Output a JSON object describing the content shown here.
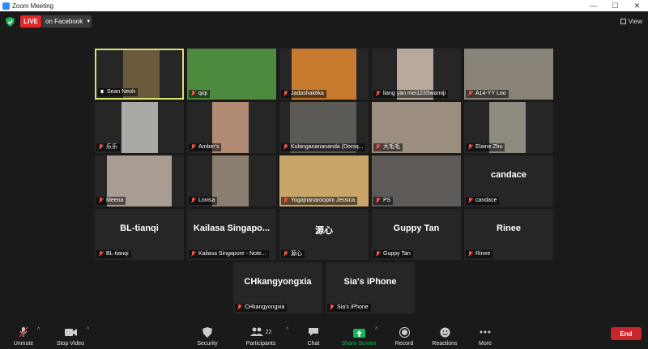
{
  "window": {
    "title": "Zoom Meeting",
    "controls": [
      "—",
      "☐",
      "✕"
    ]
  },
  "topbar": {
    "live_label": "LIVE",
    "live_destination": "on Facebook",
    "view_label": "View"
  },
  "participants": [
    {
      "name": "Sean Neoh",
      "muted": false,
      "pinned": true,
      "video": true,
      "active_speaker": true,
      "photo_color": "#6b5a3c"
    },
    {
      "name": "qiqi",
      "muted": true,
      "video": true,
      "photo_color": "#4e8a3e"
    },
    {
      "name": "Jadashaktika",
      "muted": true,
      "video": true,
      "photo_color": "#c77a2e"
    },
    {
      "name": "liang yan mei123Swamiji",
      "muted": true,
      "video": true,
      "photo_color": "#b9a99a"
    },
    {
      "name": "A14-YY Loo",
      "muted": true,
      "video": true,
      "photo_color": "#8a8378"
    },
    {
      "name": "乐乐",
      "muted": true,
      "video": true,
      "photo_color": "#a8a8a4"
    },
    {
      "name": "Amber's",
      "muted": true,
      "video": true,
      "photo_color": "#b28b74"
    },
    {
      "name": "Kulangananananda (Dorsq...",
      "muted": true,
      "video": true,
      "photo_color": "#5b5a55"
    },
    {
      "name": "大毛毛",
      "muted": true,
      "video": true,
      "photo_color": "#9b8e7e"
    },
    {
      "name": "Elaine Zhu",
      "muted": true,
      "video": true,
      "photo_color": "#8f8a80"
    },
    {
      "name": "Meena",
      "muted": true,
      "video": true,
      "photo_color": "#a99c93"
    },
    {
      "name": "Lovisa",
      "muted": true,
      "video": true,
      "photo_color": "#8a7e70"
    },
    {
      "name": "Yogajnanaroopini Jessica",
      "muted": true,
      "video": true,
      "photo_color": "#caa56a"
    },
    {
      "name": "PS",
      "muted": true,
      "video": true,
      "photo_color": "#5d5a58"
    },
    {
      "name": "candace",
      "muted": true,
      "video": false,
      "display": "candace"
    },
    {
      "name": "BL-tianqi",
      "muted": true,
      "video": false,
      "display": "BL-tianqi"
    },
    {
      "name": "Kailasa Singapore - Note...",
      "muted": true,
      "video": false,
      "display": "Kailasa  Singapo..."
    },
    {
      "name": "源心",
      "muted": true,
      "video": false,
      "display": "源心"
    },
    {
      "name": "Guppy Tan",
      "muted": true,
      "video": false,
      "display": "Guppy Tan"
    },
    {
      "name": "Rinee",
      "muted": true,
      "video": false,
      "display": "Rinee"
    },
    {
      "name": "CHkangyongxia",
      "muted": true,
      "video": false,
      "display": "CHkangyongxia"
    },
    {
      "name": "Sia's iPhone",
      "muted": true,
      "video": false,
      "display": "Sia's iPhone"
    }
  ],
  "toolbar": {
    "unmute": "Unmute",
    "stop_video": "Stop Video",
    "security": "Security",
    "participants": "Participants",
    "participant_count": "22",
    "chat": "Chat",
    "share_screen": "Share Screen",
    "record": "Record",
    "reactions": "Reactions",
    "more": "More",
    "end": "End"
  },
  "colors": {
    "live": "#e02828",
    "share_green": "#12b75c",
    "end_red": "#c9262b",
    "active_speaker": "#d7e36a"
  }
}
